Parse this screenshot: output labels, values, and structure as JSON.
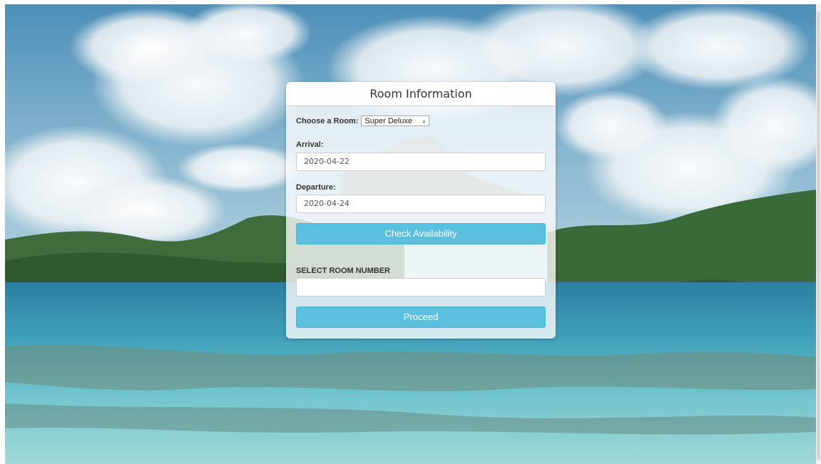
{
  "panel": {
    "title": "Room Information"
  },
  "room": {
    "label": "Choose a Room:",
    "selected": "Super Deluxe"
  },
  "arrival": {
    "label": "Arrival:",
    "value": "2020-04-22"
  },
  "departure": {
    "label": "Departure:",
    "value": "2020-04-24"
  },
  "check_button": "Check Availability",
  "room_number": {
    "label": "SELECT ROOM NUMBER",
    "value": ""
  },
  "proceed_button": "Proceed",
  "colors": {
    "accent": "#5bc0de",
    "accent_border": "#46b8da"
  }
}
